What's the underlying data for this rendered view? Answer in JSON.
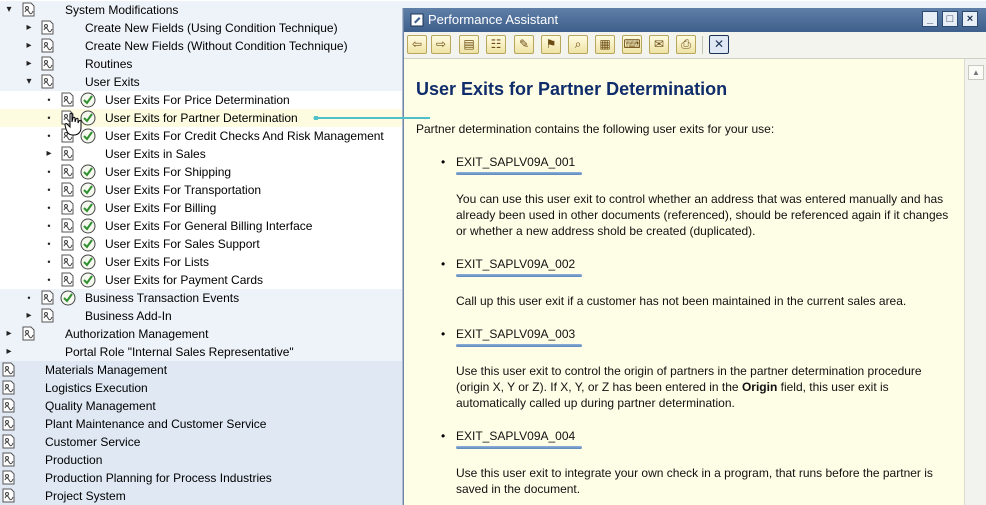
{
  "tree": {
    "rows": [
      {
        "label": "System Modifications",
        "expander": "▾",
        "level": 1,
        "bg": "light"
      },
      {
        "label": "Create New Fields (Using Condition Technique)",
        "expander": "▸",
        "level": 2,
        "bg": "light"
      },
      {
        "label": "Create New Fields (Without Condition Technique)",
        "expander": "▸",
        "level": 2,
        "bg": "light"
      },
      {
        "label": "Routines",
        "expander": "▸",
        "level": 2,
        "bg": "light"
      },
      {
        "label": "User Exits",
        "expander": "▾",
        "level": 2,
        "bg": "light"
      },
      {
        "label": "User Exits For Price Determination",
        "expander": "•",
        "level": 3,
        "activity": true,
        "bg": "white"
      },
      {
        "label": "User Exits for Partner Determination",
        "expander": "•",
        "level": 3,
        "activity": true,
        "bg": "sel"
      },
      {
        "label": "User Exits For Credit Checks And Risk Management",
        "expander": "•",
        "level": 3,
        "activity": true,
        "bg": "white"
      },
      {
        "label": "User Exits in Sales",
        "expander": "▸",
        "level": 3,
        "activity": false,
        "bg": "white"
      },
      {
        "label": "User Exits For Shipping",
        "expander": "•",
        "level": 3,
        "activity": true,
        "bg": "white"
      },
      {
        "label": "User Exits For Transportation",
        "expander": "•",
        "level": 3,
        "activity": true,
        "bg": "white"
      },
      {
        "label": "User Exits For Billing",
        "expander": "•",
        "level": 3,
        "activity": true,
        "bg": "white"
      },
      {
        "label": "User Exits For General Billing Interface",
        "expander": "•",
        "level": 3,
        "activity": true,
        "bg": "white"
      },
      {
        "label": "User Exits For Sales Support",
        "expander": "•",
        "level": 3,
        "activity": true,
        "bg": "white"
      },
      {
        "label": "User Exits For Lists",
        "expander": "•",
        "level": 3,
        "activity": true,
        "bg": "white"
      },
      {
        "label": "User Exits for Payment Cards",
        "expander": "•",
        "level": 3,
        "activity": true,
        "bg": "white"
      },
      {
        "label": "Business Transaction Events",
        "expander": "•",
        "level": 2,
        "activity": true,
        "bg": "light"
      },
      {
        "label": "Business Add-In",
        "expander": "▸",
        "level": 2,
        "activity": false,
        "bg": "light"
      },
      {
        "label": "Authorization Management",
        "expander": "▸",
        "level": 1,
        "bg": "light"
      },
      {
        "label": "Portal Role \"Internal Sales Representative\"",
        "expander": "▸",
        "level": 1,
        "bg": "light",
        "noicon": true
      },
      {
        "label": "Materials Management",
        "level": 0,
        "bg": "blue"
      },
      {
        "label": "Logistics Execution",
        "level": 0,
        "bg": "blue"
      },
      {
        "label": "Quality Management",
        "level": 0,
        "bg": "blue"
      },
      {
        "label": "Plant Maintenance and Customer Service",
        "level": 0,
        "bg": "blue"
      },
      {
        "label": "Customer Service",
        "level": 0,
        "bg": "blue"
      },
      {
        "label": "Production",
        "level": 0,
        "bg": "blue"
      },
      {
        "label": "Production Planning for Process Industries",
        "level": 0,
        "bg": "blue"
      },
      {
        "label": "Project System",
        "level": 0,
        "bg": "blue"
      }
    ]
  },
  "assistant": {
    "window_title": "Performance Assistant",
    "heading": "User Exits for Partner Determination",
    "intro": "Partner determination contains the following user exits for your use:",
    "exits": [
      {
        "name": "EXIT_SAPLV09A_001",
        "desc_html": "You can use this user exit to control whether an address that was entered manually and has already been used in other documents (referenced), should be referenced again if it changes or whether a new address shold be created (duplicated)."
      },
      {
        "name": "EXIT_SAPLV09A_002",
        "desc_html": "Call up this user exit if a customer has not been maintained in the current sales area."
      },
      {
        "name": "EXIT_SAPLV09A_003",
        "desc_pre": "Use this user exit to control the origin of partners in the partner determination procedure (origin X, Y or Z). If X, Y, or Z has been entered in the ",
        "desc_bold": "Origin",
        "desc_post": " field, this user exit is automatically called up during partner determination."
      },
      {
        "name": "EXIT_SAPLV09A_004",
        "desc_html": "Use this user exit to integrate your own check in a program, that runs before the partner is saved in the document."
      }
    ],
    "toolbar_icons": [
      "back-icon",
      "forward-icon",
      "book-icon",
      "structure-icon",
      "edit-icon",
      "flag-icon",
      "print-preview-icon",
      "table-icon",
      "keyboard-icon",
      "note-icon",
      "print-icon",
      "close-icon"
    ]
  }
}
